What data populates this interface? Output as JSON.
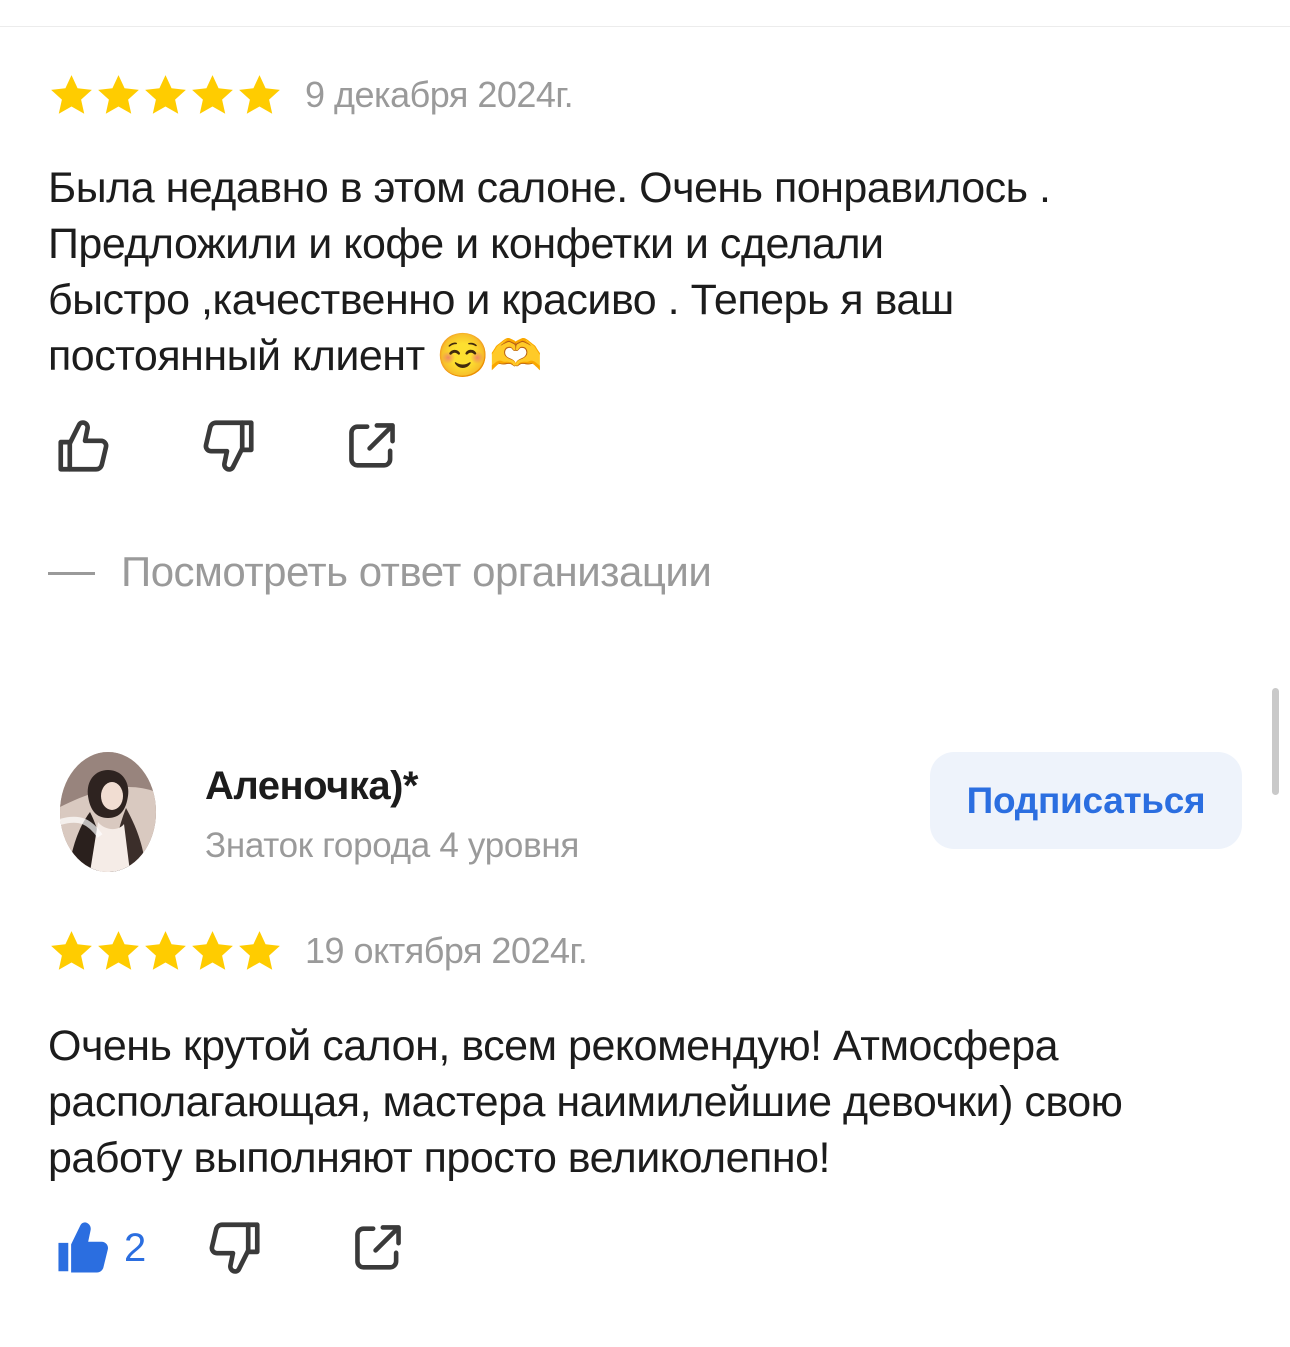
{
  "reviews": [
    {
      "rating": 5,
      "date": "9 декабря 2024г.",
      "text_lines": [
        "Была недавно в этом салоне. Очень понравилось .",
        "Предложили и кофе и конфетки и сделали",
        "быстро ,качественно и красиво . Теперь я ваш",
        "постоянный клиент ☺️🫶"
      ],
      "like_count": "",
      "org_answer_link": "Посмотреть ответ организации"
    },
    {
      "author": {
        "name": "Аленочка)*",
        "level": "Знаток города 4 уровня",
        "subscribe_label": "Подписаться"
      },
      "rating": 5,
      "date": "19 октября 2024г.",
      "text_lines": [
        "Очень крутой салон, всем рекомендую! Атмосфера",
        "располагающая, мастера наимилейшие девочки) свою",
        "работу выполняют просто великолепно!"
      ],
      "like_count": "2"
    }
  ],
  "colors": {
    "star": "#FFCC00",
    "accent": "#2B6EE0",
    "muted": "#9A9A9A",
    "icon": "#3A3A3A"
  },
  "icons": [
    "star-icon",
    "thumbs-up-icon",
    "thumbs-down-icon",
    "share-icon",
    "avatar-photo"
  ]
}
